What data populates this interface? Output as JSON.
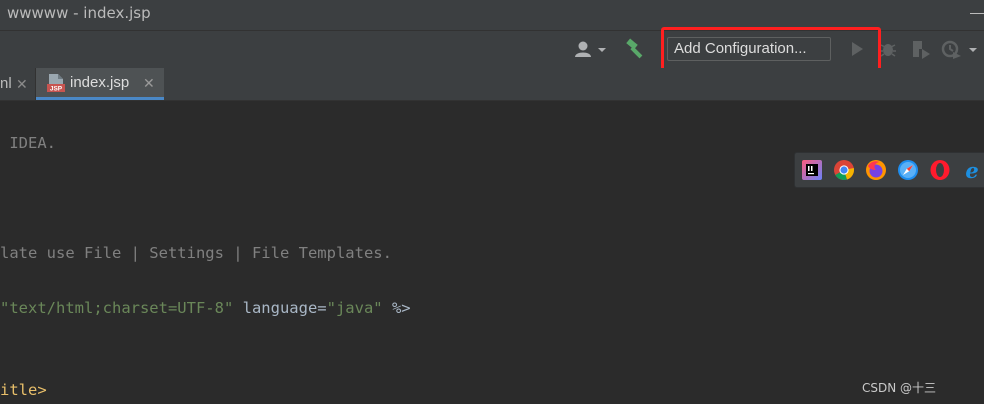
{
  "window": {
    "title": "wwwww - index.jsp"
  },
  "toolbar": {
    "user_icon": "user-icon",
    "build_icon": "hammer-icon",
    "add_configuration_label": "Add Configuration...",
    "run_icon": "run-icon",
    "debug_icon": "debug-icon",
    "coverage_icon": "coverage-icon",
    "profile_icon": "profile-icon"
  },
  "tabs": [
    {
      "label": "nl",
      "close": "✕",
      "active": false
    },
    {
      "label": "index.jsp",
      "close": "✕",
      "active": true,
      "icon": "jsp-file-icon",
      "icon_text": "JSP"
    }
  ],
  "editor": {
    "lines": [
      {
        "comment": " IDEA."
      },
      {
        "comment": "late use File | Settings | File Templates."
      },
      {
        "parts": [
          "\"text/html;charset=UTF-8\"",
          " language=",
          "\"java\"",
          " %>"
        ]
      },
      {
        "tag": "itle>"
      }
    ]
  },
  "browsers": [
    "intellij-icon",
    "chrome-icon",
    "firefox-icon",
    "safari-icon",
    "opera-icon",
    "edge-icon"
  ],
  "watermark": "CSDN @十三",
  "colors": {
    "editor_bg": "#2b2b2b",
    "chrome_bg": "#3c3f41",
    "highlight_border": "#ff1f1f",
    "active_tab_underline": "#4a88c7",
    "comment": "#808080",
    "string": "#6a8759",
    "tag": "#e8bf6a"
  }
}
